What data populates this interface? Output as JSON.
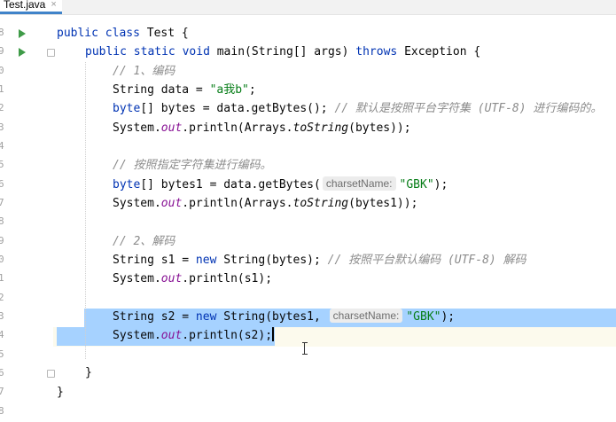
{
  "tab": {
    "label": "Test.java",
    "close": "×"
  },
  "line_numbers": [
    "8",
    "9",
    "0",
    "1",
    "2",
    "3",
    "4",
    "5",
    "6",
    "7",
    "8",
    "9",
    "0",
    "1",
    "2",
    "3",
    "4",
    "5",
    "6",
    "7",
    "8"
  ],
  "code": {
    "l1": {
      "kw1": "public",
      "kw2": "class",
      "name": "Test {"
    },
    "l2": {
      "kw1": "public",
      "kw2": "static",
      "kw3": "void",
      "sig": "main(String[] args)",
      "kw4": "throws",
      "rest": "Exception {"
    },
    "l3": {
      "comment": "// 1、编码"
    },
    "l4": {
      "pre": "String data = ",
      "str": "\"a我b\"",
      "post": ";"
    },
    "l5": {
      "kw": "byte",
      "code": "[] bytes = data.getBytes(); ",
      "comment": "// 默认是按照平台字符集 (UTF-8) 进行编码的。"
    },
    "l6": {
      "pre": "System.",
      "field": "out",
      "mid": ".println(Arrays.",
      "method": "toString",
      "post": "(bytes));"
    },
    "l7": {
      "comment": "// 按照指定字符集进行编码。"
    },
    "l8": {
      "kw": "byte",
      "code": "[] bytes1 = data.getBytes(",
      "hint": "charsetName:",
      "str": "\"GBK\"",
      "post": ");"
    },
    "l9": {
      "pre": "System.",
      "field": "out",
      "mid": ".println(Arrays.",
      "method": "toString",
      "post": "(bytes1));"
    },
    "l10": {
      "comment": "// 2、解码"
    },
    "l11": {
      "pre": "String s1 = ",
      "kw": "new",
      "code": " String(bytes); ",
      "comment": "// 按照平台默认编码 (UTF-8) 解码"
    },
    "l12": {
      "pre": "System.",
      "field": "out",
      "post": ".println(s1);"
    },
    "l13": {
      "pre": "String s2 = ",
      "kw": "new",
      "code": " String(bytes1, ",
      "hint": "charsetName:",
      "str": "\"GBK\"",
      "post": ");"
    },
    "l14": {
      "pre": "System.",
      "field": "out",
      "post": ".println(s2);"
    },
    "l15": {
      "brace": "}"
    },
    "l16": {
      "brace": "}"
    }
  },
  "colors": {
    "keyword": "#0033b3",
    "string": "#067d17",
    "comment": "#8c8c8c",
    "field": "#871094",
    "selection": "#a6d2ff",
    "caret_line": "#fcfaed",
    "run": "#3f9b48"
  },
  "icons": {
    "run": "run-triangle-icon",
    "fold": "fold-marker-icon",
    "cursor": "text-cursor-icon"
  }
}
